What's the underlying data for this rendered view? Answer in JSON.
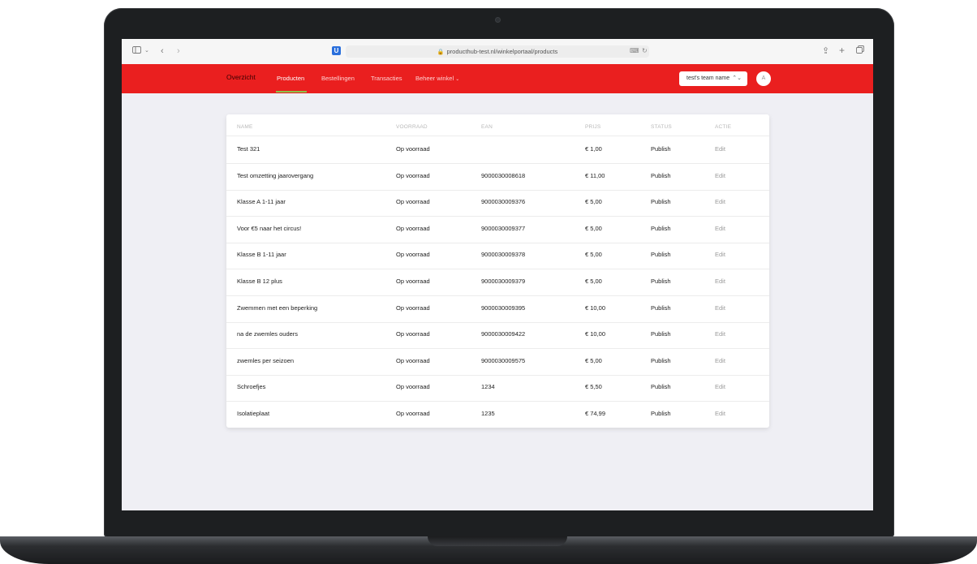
{
  "browser": {
    "url": "producthub-test.nl/winkelportaal/products",
    "lock_icon": "lock-icon",
    "extension_label": "U"
  },
  "nav": {
    "brand": "Overzicht",
    "items": [
      {
        "label": "Producten",
        "active": true
      },
      {
        "label": "Bestellingen",
        "active": false
      },
      {
        "label": "Transacties",
        "active": false
      },
      {
        "label": "Beheer winkel",
        "active": false
      }
    ],
    "team_select": "test's team name",
    "avatar": "A",
    "colors": {
      "bar": "#ea1f1f",
      "active_underline": "#8bc34a"
    }
  },
  "table": {
    "headers": [
      "NAME",
      "VOORRAAD",
      "EAN",
      "PRIJS",
      "STATUS",
      "ACTIE"
    ],
    "rows": [
      {
        "name": "Test 321",
        "voorraad": "Op voorraad",
        "ean": "",
        "prijs": "€ 1,00",
        "status": "Publish",
        "actie": "Edit"
      },
      {
        "name": "Test omzetting jaarovergang",
        "voorraad": "Op voorraad",
        "ean": "9000030008618",
        "prijs": "€ 11,00",
        "status": "Publish",
        "actie": "Edit"
      },
      {
        "name": "Klasse A 1-11 jaar",
        "voorraad": "Op voorraad",
        "ean": "9000030009376",
        "prijs": "€ 5,00",
        "status": "Publish",
        "actie": "Edit"
      },
      {
        "name": "Voor €5 naar het circus!",
        "voorraad": "Op voorraad",
        "ean": "9000030009377",
        "prijs": "€ 5,00",
        "status": "Publish",
        "actie": "Edit"
      },
      {
        "name": "Klasse B 1-11 jaar",
        "voorraad": "Op voorraad",
        "ean": "9000030009378",
        "prijs": "€ 5,00",
        "status": "Publish",
        "actie": "Edit"
      },
      {
        "name": "Klasse B 12 plus",
        "voorraad": "Op voorraad",
        "ean": "9000030009379",
        "prijs": "€ 5,00",
        "status": "Publish",
        "actie": "Edit"
      },
      {
        "name": "Zwemmen met een beperking",
        "voorraad": "Op voorraad",
        "ean": "9000030009395",
        "prijs": "€ 10,00",
        "status": "Publish",
        "actie": "Edit"
      },
      {
        "name": "na de zwemles ouders",
        "voorraad": "Op voorraad",
        "ean": "9000030009422",
        "prijs": "€ 10,00",
        "status": "Publish",
        "actie": "Edit"
      },
      {
        "name": "zwemles per seizoen",
        "voorraad": "Op voorraad",
        "ean": "9000030009575",
        "prijs": "€ 5,00",
        "status": "Publish",
        "actie": "Edit"
      },
      {
        "name": "Schroefjes",
        "voorraad": "Op voorraad",
        "ean": "1234",
        "prijs": "€ 5,50",
        "status": "Publish",
        "actie": "Edit"
      },
      {
        "name": "Isolatieplaat",
        "voorraad": "Op voorraad",
        "ean": "1235",
        "prijs": "€ 74,99",
        "status": "Publish",
        "actie": "Edit"
      }
    ]
  }
}
